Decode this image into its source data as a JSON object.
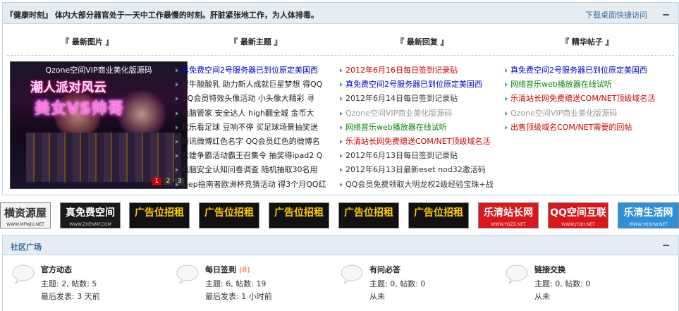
{
  "top": {
    "health_tip": "『健康时刻』 体内大部分器官处于一天中工作最慢的时刻。肝脏紧张地工作，为人体排毒。",
    "desktop_link": "下载桌面快捷访问",
    "columns": {
      "pictures": "『 最新图片 』",
      "topics": "『 最新主题 』",
      "replies": "『 最新回复 』",
      "featured": "『 精华帖子 』"
    },
    "promo": {
      "title": "Qzone空间VIP商业美化版源码",
      "big1": "潮人派对风云",
      "big2": "美女VS帅哥",
      "pages": [
        "1",
        "2",
        "3"
      ]
    },
    "topics": [
      {
        "text": "真免费空间2号服务器已到位原定美国西",
        "color": "#0000cc"
      },
      {
        "text": "蒙牛酸酸乳 助力新人成就巨星梦想 得QQ",
        "color": "#222222"
      },
      {
        "text": "QQ会员特效头像活动 小头像大精彩 寻",
        "color": "#222222"
      },
      {
        "text": "电脑管家 安全达人 high翻全城 金币大",
        "color": "#222222"
      },
      {
        "text": "欢乐看足球 豆响不停 买足球场景抽奖送",
        "color": "#222222"
      },
      {
        "text": "腾讯微博红色名字 QQ会员红色的微博名",
        "color": "#222222"
      },
      {
        "text": "七雄争霸活动霸王召集令 抽奖得ipad2 Q",
        "color": "#222222"
      },
      {
        "text": "电脑安全认知问卷调查 随机抽取30名用",
        "color": "#222222"
      },
      {
        "text": "Jeep指南者欧洲杯竞猜活动 得3个月QQ红",
        "color": "#222222"
      }
    ],
    "replies": [
      {
        "text": "2012年6月16日每日签到记录贴",
        "color": "#cc0000"
      },
      {
        "text": "真免费空间2号服务器已到位原定美国西",
        "color": "#0000cc"
      },
      {
        "text": "2012年6月14日每日签到记录贴",
        "color": "#333333"
      },
      {
        "text": "Qzone空间VIP商业美化版源码",
        "color": "#999999"
      },
      {
        "text": "网络音乐web播放器在线试听",
        "color": "#008800"
      },
      {
        "text": "乐清站长网免费赠送COM/NET顶级域名活",
        "color": "#cc0000"
      },
      {
        "text": "2012年6月13日每日签到记录贴",
        "color": "#333333"
      },
      {
        "text": "2012年6月13日最新eset nod32激活码",
        "color": "#333333"
      },
      {
        "text": "QQ会员免费领取大明龙权2级经验宝珠+战",
        "color": "#333333"
      }
    ],
    "featured": [
      {
        "text": "真免费空间2号服务器已到位原定美国西",
        "color": "#0000cc"
      },
      {
        "text": "网络音乐web播放器在线试听",
        "color": "#008800"
      },
      {
        "text": "乐清站长网免费赠送COM/NET顶级域名活",
        "color": "#cc0000"
      },
      {
        "text": "Qzone空间VIP商业美化版源码",
        "color": "#999999"
      },
      {
        "text": "出售顶级域名COM/NET需要的回帖",
        "color": "#cc0000"
      }
    ]
  },
  "banners": [
    {
      "big": "横资源屋",
      "small": "WWW.MFWJU.NET",
      "bg": "#f2f2f2",
      "fg": "#333333",
      "sfg": "#333333"
    },
    {
      "big": "真免费空间",
      "small": "WWW.ZHENMF.COM",
      "bg": "#1a1a1a",
      "fg": "#ffffff",
      "sfg": "#cccccc"
    },
    {
      "big": "广告位招租",
      "small": "",
      "bg": "#111111",
      "fg": "#ffcc00",
      "sfg": "#ffffff"
    },
    {
      "big": "广告位招租",
      "small": "",
      "bg": "#111111",
      "fg": "#ffcc00",
      "sfg": "#ffffff"
    },
    {
      "big": "广告位招租",
      "small": "",
      "bg": "#111111",
      "fg": "#ffcc00",
      "sfg": "#ffffff"
    },
    {
      "big": "广告位招租",
      "small": "",
      "bg": "#111111",
      "fg": "#ffcc00",
      "sfg": "#ffffff"
    },
    {
      "big": "广告位招租",
      "small": "",
      "bg": "#111111",
      "fg": "#ffcc00",
      "sfg": "#ffffff"
    },
    {
      "big": "乐清站长网",
      "small": "WWW.YQZZ.NET",
      "bg": "#d8181c",
      "fg": "#ffffff",
      "sfg": "#ffdddd"
    },
    {
      "big": "QQ空间互联",
      "small": "WWW.JYQH.NET",
      "bg": "#d8181c",
      "fg": "#ffffff",
      "sfg": "#ffdddd"
    },
    {
      "big": "乐清生活网",
      "small": "WWW.YQSHW.NET",
      "bg": "#2f8fd8",
      "fg": "#ffffff",
      "sfg": "#e6f2ff"
    }
  ],
  "community": {
    "title": "社区广场",
    "forums": [
      {
        "name": "官方动态",
        "today": "",
        "stats": "主题: 2, 帖数: 5",
        "last": "最后发表: 3 天前"
      },
      {
        "name": "每日签到",
        "today": "(8)",
        "stats": "主题: 6, 帖数: 19",
        "last": "最后发表: 1 小时前"
      },
      {
        "name": "有问必答",
        "today": "",
        "stats": "主题: 0, 帖数: 0",
        "last": "从未"
      },
      {
        "name": "链接交换",
        "today": "",
        "stats": "主题: 0, 帖数: 0",
        "last": "从未"
      }
    ]
  },
  "colors": {
    "box_border": "#c2d5e3",
    "bar_bg": "#e5edf2",
    "link_blue": "#336699"
  }
}
